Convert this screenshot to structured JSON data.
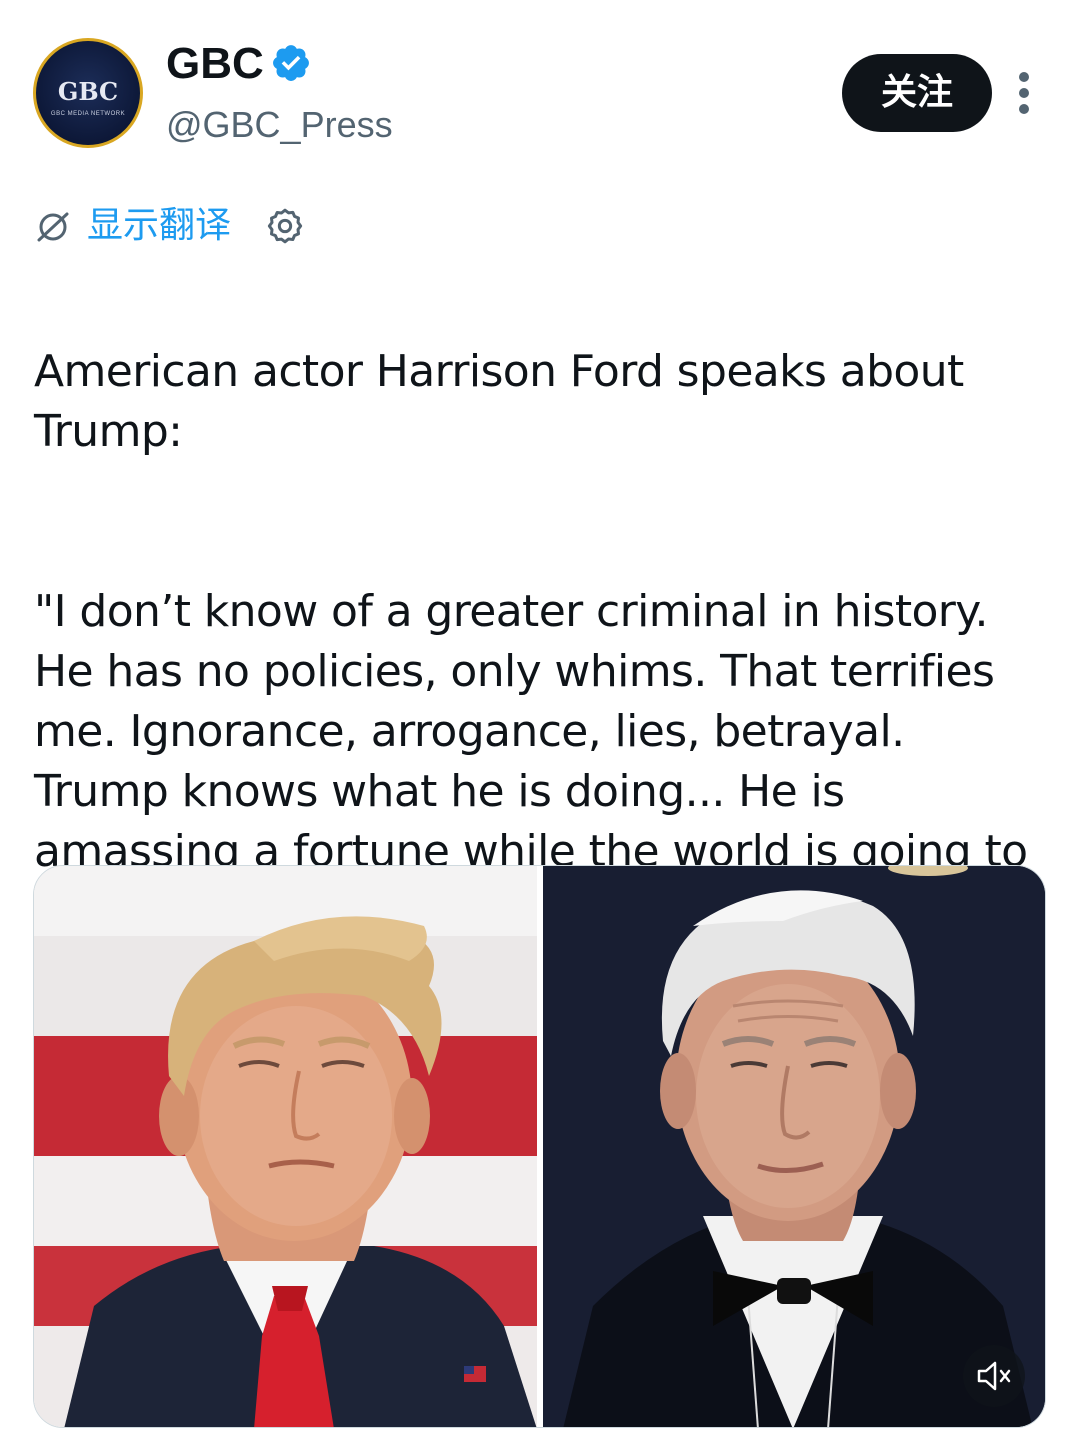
{
  "account": {
    "display_name": "GBC",
    "handle": "@GBC_Press",
    "avatar_text": "GBC",
    "avatar_subtext": "GBC MEDIA NETWORK",
    "verified": true
  },
  "actions": {
    "follow_label": "关注"
  },
  "translate": {
    "label": "显示翻译"
  },
  "tweet": {
    "paragraphs": [
      "American actor Harrison Ford speaks about Trump:",
      "\"I don’t know of a greater criminal in history. He has no policies, only whims. That terrifies me. Ignorance, arrogance, lies, betrayal. Trump knows what he is doing... He is amassing a fortune while the world is going to hell.\""
    ]
  },
  "media": {
    "photos": [
      {
        "name": "photo-left"
      },
      {
        "name": "photo-right"
      }
    ],
    "muted": true
  },
  "colors": {
    "accent": "#1d9bf0",
    "text_primary": "#0f1419",
    "text_secondary": "#536471",
    "follow_bg": "#0f1419",
    "avatar_ring": "#d9a722",
    "avatar_bg": "#0d1838"
  },
  "icons": [
    "verified-badge-icon",
    "more-icon",
    "translate-icon",
    "settings-icon",
    "mute-icon"
  ]
}
